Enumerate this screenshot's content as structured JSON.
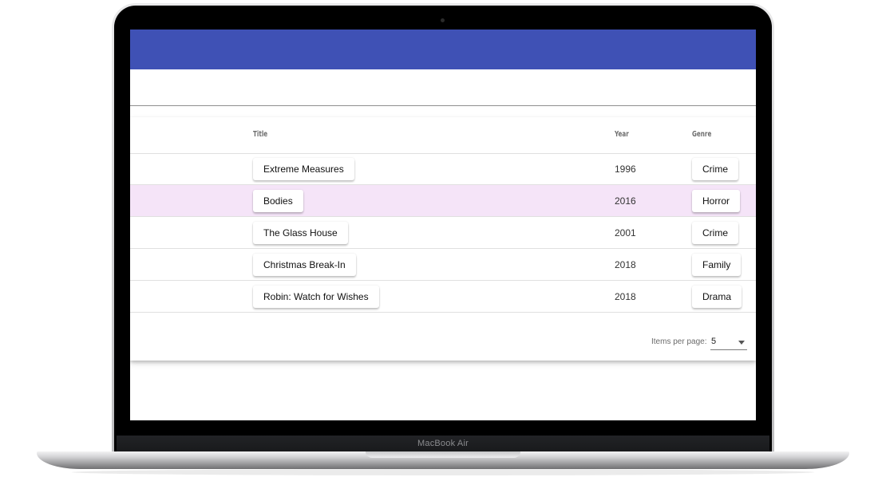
{
  "device": {
    "label": "MacBook Air"
  },
  "table": {
    "headers": {
      "title": "Title",
      "year": "Year",
      "genre": "Genre"
    },
    "rows": [
      {
        "title": "Extreme Measures",
        "year": "1996",
        "genre": "Crime"
      },
      {
        "title": "Bodies",
        "year": "2016",
        "genre": "Horror",
        "highlighted": true
      },
      {
        "title": "The Glass House",
        "year": "2001",
        "genre": "Crime"
      },
      {
        "title": "Christmas Break-In",
        "year": "2018",
        "genre": "Family"
      },
      {
        "title": "Robin: Watch for Wishes",
        "year": "2018",
        "genre": "Drama"
      }
    ]
  },
  "paginator": {
    "items_per_page_label": "Items per page:",
    "page_size": "5"
  },
  "colors": {
    "toolbar": "#3f51b5",
    "highlight_row": "#f5e4f8"
  }
}
